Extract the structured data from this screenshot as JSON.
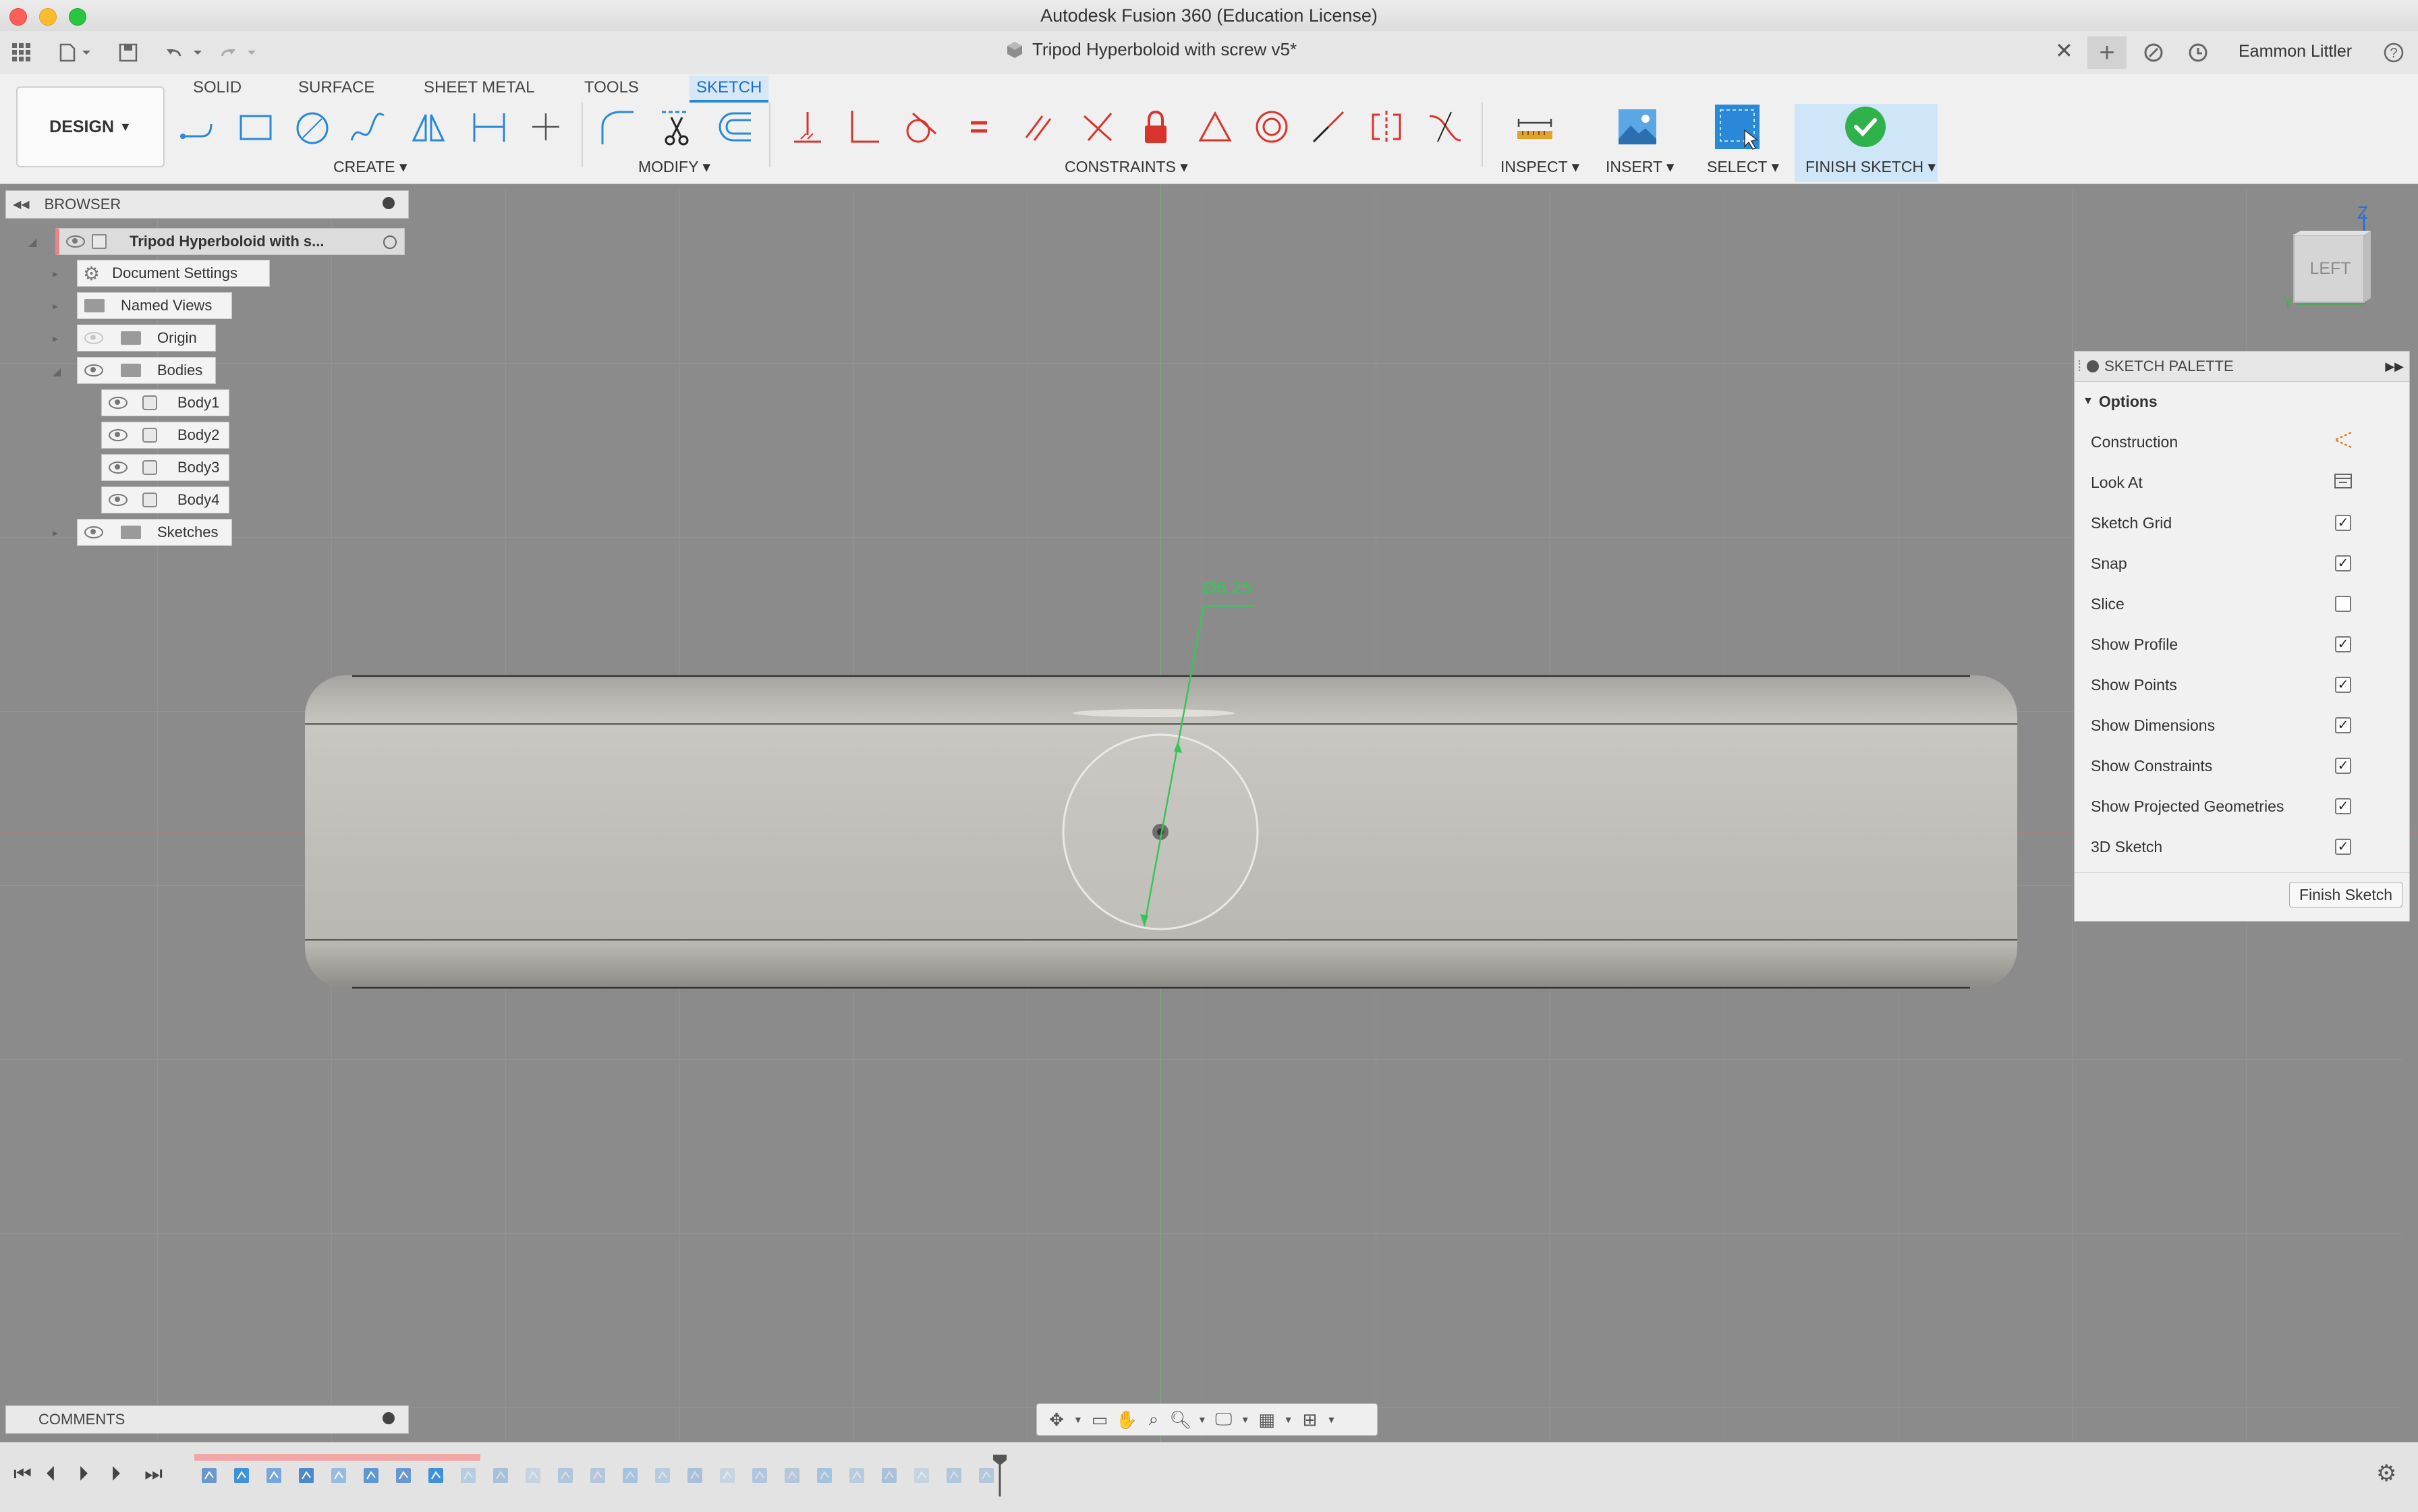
{
  "window": {
    "title": "Autodesk Fusion 360 (Education License)"
  },
  "tabbar": {
    "document_tab": "Tripod Hyperboloid with screw v5*",
    "user": "Eammon Littler"
  },
  "ribbon": {
    "workspace": "DESIGN",
    "tabs": [
      "SOLID",
      "SURFACE",
      "SHEET METAL",
      "TOOLS",
      "SKETCH"
    ],
    "active_tab": "SKETCH",
    "groups": {
      "create": "CREATE",
      "modify": "MODIFY",
      "constraints": "CONSTRAINTS",
      "inspect": "INSPECT",
      "insert": "INSERT",
      "select": "SELECT",
      "finish": "FINISH SKETCH"
    }
  },
  "browser": {
    "title": "BROWSER",
    "root": "Tripod Hyperboloid with s...",
    "items": {
      "document_settings": "Document Settings",
      "named_views": "Named Views",
      "origin": "Origin",
      "bodies": "Bodies",
      "body1": "Body1",
      "body2": "Body2",
      "body3": "Body3",
      "body4": "Body4",
      "sketches": "Sketches"
    }
  },
  "canvas": {
    "dimension": "Ø6.25"
  },
  "viewcube": {
    "face": "LEFT",
    "axis_z": "Z",
    "axis_y": "Y"
  },
  "palette": {
    "title": "SKETCH PALETTE",
    "section": "Options",
    "rows": {
      "construction": "Construction",
      "look_at": "Look At",
      "sketch_grid": "Sketch Grid",
      "snap": "Snap",
      "slice": "Slice",
      "show_profile": "Show Profile",
      "show_points": "Show Points",
      "show_dimensions": "Show Dimensions",
      "show_constraints": "Show Constraints",
      "show_projected": "Show Projected Geometries",
      "sketch_3d": "3D Sketch"
    },
    "checked": {
      "sketch_grid": true,
      "snap": true,
      "slice": false,
      "show_profile": true,
      "show_points": true,
      "show_dimensions": true,
      "show_constraints": true,
      "show_projected": true,
      "sketch_3d": true
    },
    "finish_button": "Finish Sketch"
  },
  "comments": {
    "title": "COMMENTS"
  },
  "colors": {
    "accent": "#2a88d8",
    "sketch_green": "#39c45a",
    "finish_green": "#2fb24c",
    "constraint_red": "#d9342b"
  }
}
